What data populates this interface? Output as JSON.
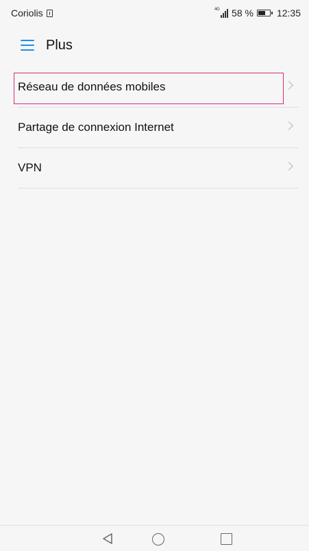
{
  "status_bar": {
    "carrier": "Coriolis",
    "network_type": "4G",
    "battery_percent": "58 %",
    "time": "12:35"
  },
  "header": {
    "title": "Plus"
  },
  "settings": {
    "items": [
      {
        "label": "Réseau de données mobiles",
        "highlighted": true
      },
      {
        "label": "Partage de connexion Internet",
        "highlighted": false
      },
      {
        "label": "VPN",
        "highlighted": false
      }
    ]
  },
  "colors": {
    "accent": "#1d8fe6",
    "highlight": "#d8287e"
  },
  "icons": {
    "menu": "hamburger-menu-icon",
    "chevron": "chevron-right-icon",
    "back": "back-triangle-icon",
    "home": "home-circle-icon",
    "recents": "recents-square-icon"
  }
}
